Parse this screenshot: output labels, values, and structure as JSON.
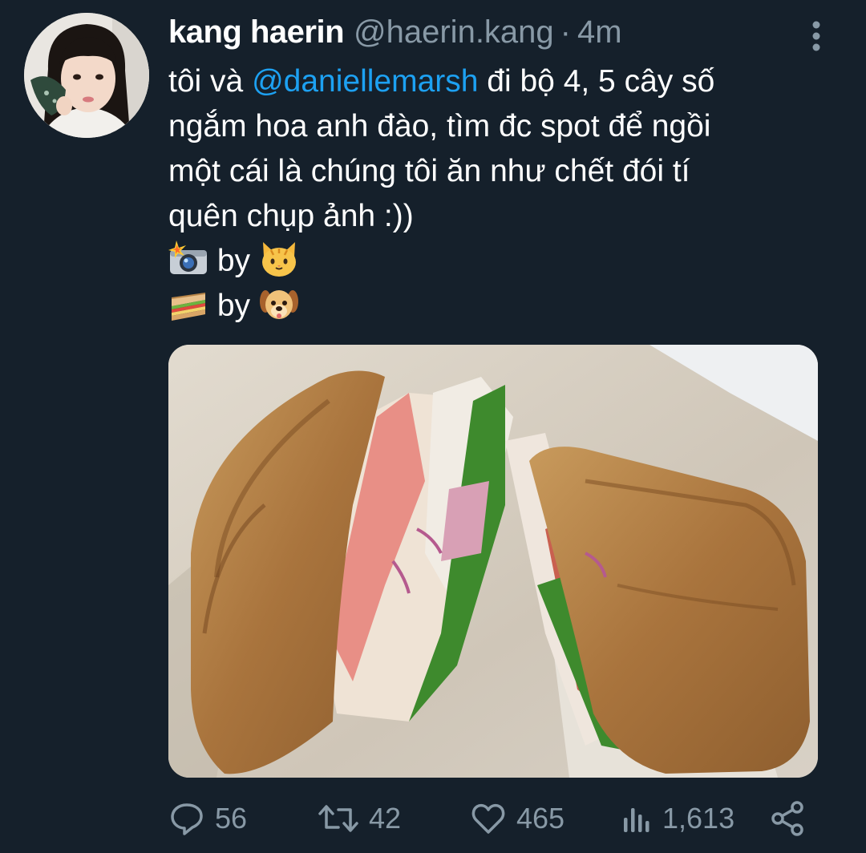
{
  "author": {
    "display_name": "kang haerin",
    "handle": "@haerin.kang",
    "separator": "·",
    "time": "4m"
  },
  "tweet": {
    "line1_prefix": "tôi và ",
    "mention": "@daniellemarsh",
    "line1_suffix": " đi bộ 4, 5 cây số",
    "line2": "ngắm hoa anh đào, tìm đc spot để ngồi",
    "line3": "một cái là chúng tôi ăn như chết đói tí",
    "line4": "quên chụp ảnh :))",
    "line5_text": "by",
    "line6_text": "by",
    "emojis": {
      "line5_first": "camera-with-flash-icon",
      "line5_second": "cat-face-icon",
      "line6_first": "sandwich-icon",
      "line6_second": "dog-face-icon"
    }
  },
  "media": {
    "description_icon": "sandwich-photo"
  },
  "actions": {
    "reply_count": "56",
    "retweet_count": "42",
    "like_count": "465",
    "views_count": "1,613"
  },
  "colors": {
    "background": "#15202b",
    "text": "#ffffff",
    "muted": "#8899a6",
    "link": "#1da1f2"
  }
}
